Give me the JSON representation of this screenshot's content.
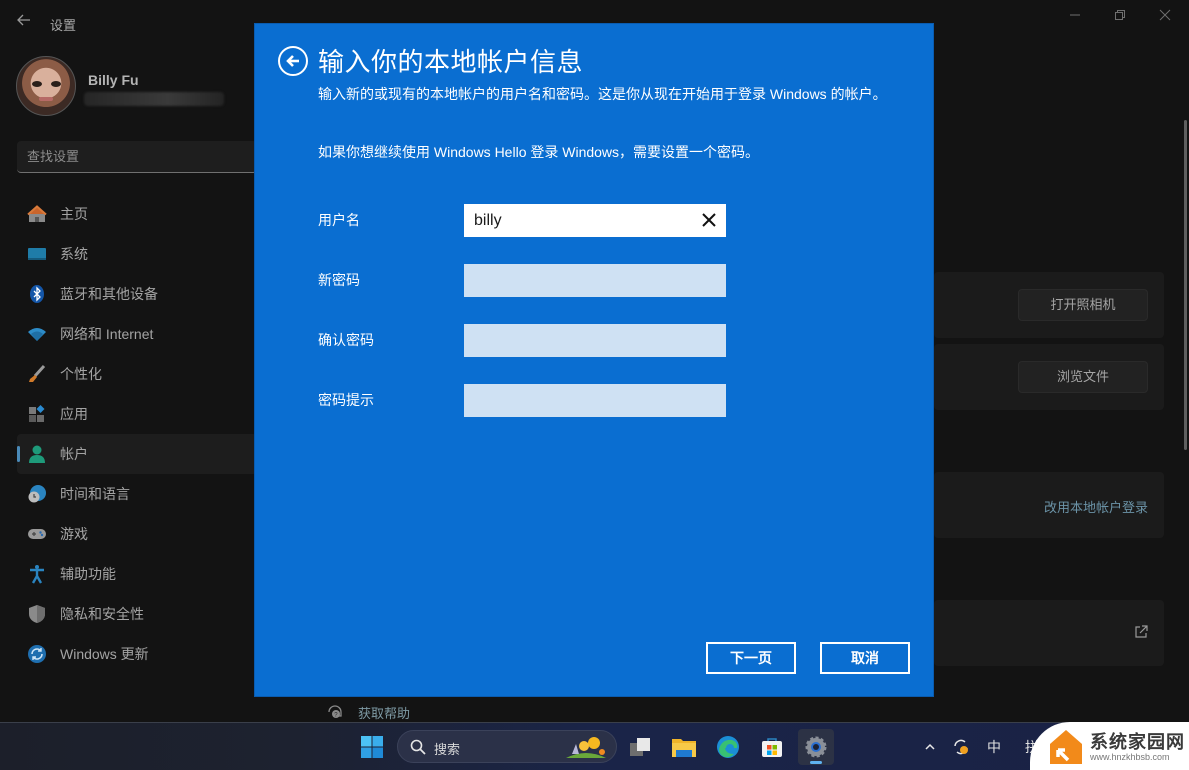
{
  "window": {
    "title": "设置",
    "back_icon": "arrow-left-icon",
    "controls": [
      "minimize",
      "restore",
      "close"
    ]
  },
  "profile": {
    "name": "Billy Fu",
    "email": ""
  },
  "search": {
    "placeholder": "查找设置"
  },
  "sidebar": {
    "items": [
      {
        "label": "主页",
        "icon": "home-icon",
        "active": false
      },
      {
        "label": "系统",
        "icon": "system-icon",
        "active": false
      },
      {
        "label": "蓝牙和其他设备",
        "icon": "bluetooth-icon",
        "active": false
      },
      {
        "label": "网络和 Internet",
        "icon": "wifi-icon",
        "active": false
      },
      {
        "label": "个性化",
        "icon": "brush-icon",
        "active": false
      },
      {
        "label": "应用",
        "icon": "apps-icon",
        "active": false
      },
      {
        "label": "帐户",
        "icon": "account-icon",
        "active": true
      },
      {
        "label": "时间和语言",
        "icon": "time-language-icon",
        "active": false
      },
      {
        "label": "游戏",
        "icon": "gamepad-icon",
        "active": false
      },
      {
        "label": "辅助功能",
        "icon": "accessibility-icon",
        "active": false
      },
      {
        "label": "隐私和安全性",
        "icon": "shield-icon",
        "active": false
      },
      {
        "label": "Windows 更新",
        "icon": "update-icon",
        "active": false
      }
    ]
  },
  "background_content": {
    "open_camera_label": "打开照相机",
    "browse_files_label": "浏览文件",
    "switch_local_label": "改用本地帐户登录",
    "get_help_label": "获取帮助"
  },
  "dialog": {
    "title": "输入你的本地帐户信息",
    "description": "输入新的或现有的本地帐户的用户名和密码。这是你从现在开始用于登录 Windows 的帐户。",
    "hello_note": "如果你想继续使用 Windows Hello 登录 Windows，需要设置一个密码。",
    "fields": [
      {
        "label": "用户名",
        "value": "billy"
      },
      {
        "label": "新密码",
        "value": ""
      },
      {
        "label": "确认密码",
        "value": ""
      },
      {
        "label": "密码提示",
        "value": ""
      }
    ],
    "next_label": "下一页",
    "cancel_label": "取消",
    "accent_color": "#0a6ed1"
  },
  "taskbar": {
    "search_label": "搜索",
    "apps": [
      "start",
      "search",
      "task-view",
      "file-explorer",
      "edge",
      "store",
      "settings"
    ],
    "active_app": "settings",
    "tray": {
      "ime_label": "中",
      "ime2_label": "拼"
    }
  },
  "watermark": {
    "title": "系统家园网",
    "url": "www.hnzkhbsb.com"
  }
}
